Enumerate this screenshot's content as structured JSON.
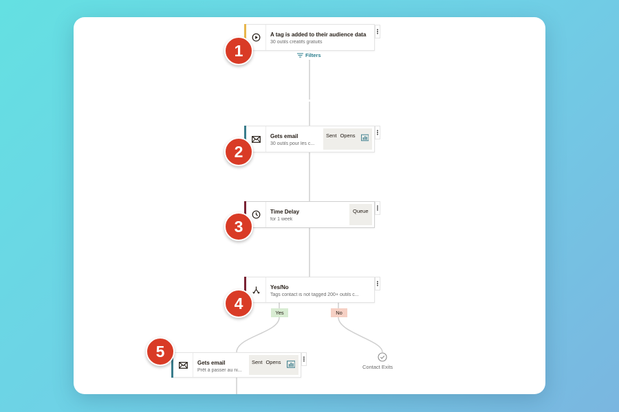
{
  "colors": {
    "trigger_accent": "#e8b64c",
    "email_accent": "#3a7d8c",
    "delay_accent": "#7a2233",
    "condition_accent": "#7a2233",
    "badge": "#d93b26",
    "yes_tag": "#d8ecd2",
    "no_tag": "#f6d0c4",
    "filter_text": "#2a7d8c"
  },
  "steps": [
    {
      "number": "1",
      "type": "trigger",
      "icon": "play-circle-icon",
      "title": "A tag is added to their audience data",
      "subtitle": "30 outils créatifs gratuits"
    },
    {
      "number": "2",
      "type": "email",
      "icon": "envelope-icon",
      "title": "Gets email",
      "subtitle": "30 outils pour les c...",
      "stat1": "Sent",
      "stat2": "Opens",
      "stat_icon": "bar-chart-icon"
    },
    {
      "number": "3",
      "type": "delay",
      "icon": "clock-icon",
      "title": "Time Delay",
      "subtitle": "for 1 week",
      "stat1": "Queue"
    },
    {
      "number": "4",
      "type": "condition",
      "icon": "split-icon",
      "title": "Yes/No",
      "subtitle": "Tags contact is not tagged 200+ outils c..."
    },
    {
      "number": "5",
      "type": "email",
      "icon": "envelope-icon",
      "title": "Gets email",
      "subtitle": "Prêt à passer au ni...",
      "stat1": "Sent",
      "stat2": "Opens",
      "stat_icon": "bar-chart-icon"
    }
  ],
  "filters_label": "Filters",
  "kebab_glyph": "⋮",
  "branches": {
    "yes": "Yes",
    "no": "No"
  },
  "exit": {
    "label": "Contact Exits",
    "icon": "check-circle-icon"
  }
}
